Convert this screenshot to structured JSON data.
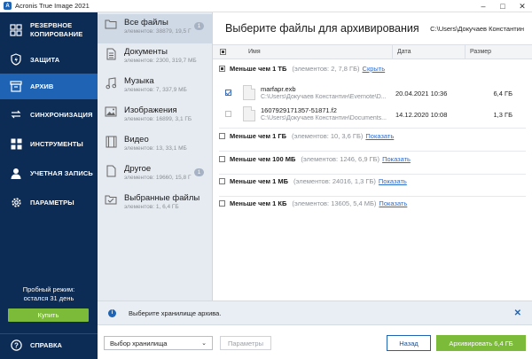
{
  "window": {
    "title": "Acronis True Image 2021"
  },
  "sidebar": {
    "items": [
      {
        "label": "РЕЗЕРВНОЕ\nКОПИРОВАНИЕ"
      },
      {
        "label": "ЗАЩИТА"
      },
      {
        "label": "АРХИВ"
      },
      {
        "label": "СИНХРОНИЗАЦИЯ"
      },
      {
        "label": "ИНСТРУМЕНТЫ"
      },
      {
        "label": "УЧЕТНАЯ ЗАПИСЬ"
      },
      {
        "label": "ПАРАМЕТРЫ"
      }
    ],
    "trial_line1": "Пробный режим:",
    "trial_line2": "остался 31 день",
    "buy_label": "Купить",
    "help_label": "СПРАВКА"
  },
  "categories": [
    {
      "name": "Все файлы",
      "sub": "элементов: 38879, 19,5 Г",
      "badge": "1"
    },
    {
      "name": "Документы",
      "sub": "элементов: 2300, 319,7 МБ"
    },
    {
      "name": "Музыка",
      "sub": "элементов: 7, 337,9 МБ"
    },
    {
      "name": "Изображения",
      "sub": "элементов: 16899, 3,1 ГБ"
    },
    {
      "name": "Видео",
      "sub": "элементов: 13, 33,1 МБ"
    },
    {
      "name": "Другое",
      "sub": "элементов: 19660, 15,8 Г",
      "badge": "1"
    },
    {
      "name": "Выбранные файлы",
      "sub": "элементов: 1, 6,4 ГБ"
    }
  ],
  "main": {
    "title": "Выберите файлы для архивирования",
    "path": "C:\\Users\\Докучаев Константин",
    "columns": {
      "name": "Имя",
      "date": "Дата",
      "size": "Размер"
    },
    "groups": [
      {
        "label": "Меньше чем 1 ТБ",
        "meta": "(элементов: 2, 7,8 ГБ)",
        "link": "Скрыть"
      },
      {
        "label": "Меньше чем 1 ГБ",
        "meta": "(элементов: 10, 3,6 ГБ)",
        "link": "Показать"
      },
      {
        "label": "Меньше чем 100 МБ",
        "meta": "(элементов: 1246, 6,9 ГБ)",
        "link": "Показать"
      },
      {
        "label": "Меньше чем 1 МБ",
        "meta": "(элементов: 24016, 1,3 ГБ)",
        "link": "Показать"
      },
      {
        "label": "Меньше чем 1 КБ",
        "meta": "(элементов: 13605, 5,4 МБ)",
        "link": "Показать"
      }
    ],
    "files": [
      {
        "name": "marfapr.exb",
        "path": "C:\\Users\\Докучаев Константин\\Evernote\\D...",
        "date": "20.04.2021 10:36",
        "size": "6,4 ГБ",
        "checked": true
      },
      {
        "name": "1607929171357-51871.f2",
        "path": "C:\\Users\\Докучаев Константин\\Documents...",
        "date": "14.12.2020 10:08",
        "size": "1,3 ГБ",
        "checked": false
      }
    ]
  },
  "info": {
    "text": "Выберите хранилище архива."
  },
  "footer": {
    "storage_select": "Выбор хранилища",
    "params_label": "Параметры",
    "back_label": "Назад",
    "archive_label": "Архивировать 6,4 ГБ"
  },
  "colors": {
    "sidebar": "#0c2b55",
    "active": "#1f64b4",
    "accent_green": "#7cba3a",
    "link": "#2a6bd1"
  }
}
